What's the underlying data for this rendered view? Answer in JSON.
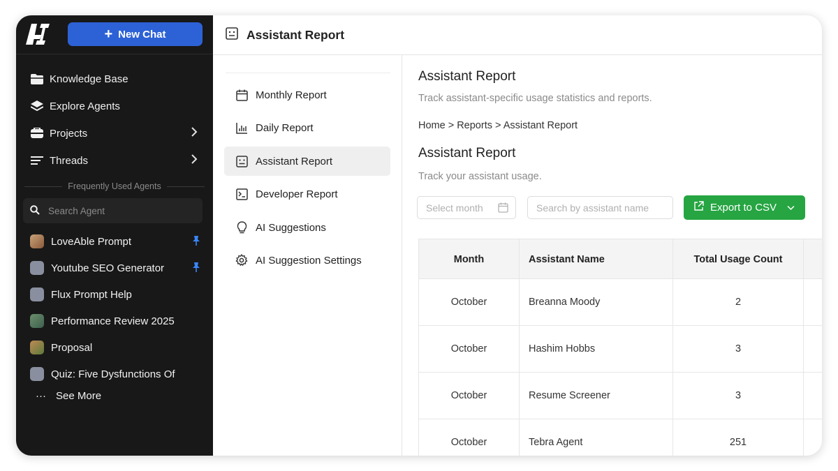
{
  "sidebar": {
    "new_chat_label": "New Chat",
    "nav": [
      {
        "label": "Knowledge Base",
        "icon": "folder-icon"
      },
      {
        "label": "Explore Agents",
        "icon": "layers-icon"
      },
      {
        "label": "Projects",
        "icon": "projects-icon"
      },
      {
        "label": "Threads",
        "icon": "threads-icon"
      }
    ],
    "frequently_used_label": "Frequently Used Agents",
    "search_placeholder": "Search Agent",
    "agents": [
      {
        "label": "LoveAble Prompt",
        "pinned": true
      },
      {
        "label": "Youtube SEO Generator",
        "pinned": true
      },
      {
        "label": "Flux Prompt Help",
        "pinned": false
      },
      {
        "label": "Performance Review 2025",
        "pinned": false
      },
      {
        "label": "Proposal",
        "pinned": false
      },
      {
        "label": "Quiz: Five Dysfunctions Of",
        "pinned": false
      }
    ],
    "see_more_label": "See More"
  },
  "header": {
    "title": "Assistant Report"
  },
  "submenu": [
    {
      "label": "Monthly Report",
      "icon": "calendar-icon"
    },
    {
      "label": "Daily Report",
      "icon": "bar-chart-icon"
    },
    {
      "label": "Assistant Report",
      "icon": "assistant-icon",
      "active": true
    },
    {
      "label": "Developer Report",
      "icon": "terminal-icon"
    },
    {
      "label": "AI Suggestions",
      "icon": "lightbulb-icon"
    },
    {
      "label": "AI Suggestion Settings",
      "icon": "gear-icon"
    }
  ],
  "main": {
    "title": "Assistant Report",
    "subtitle": "Track assistant-specific usage statistics and reports.",
    "breadcrumb": "Home > Reports > Assistant Report",
    "section_title": "Assistant Report",
    "section_subtitle": "Track your assistant usage.",
    "month_placeholder": "Select month",
    "name_placeholder": "Search by assistant name",
    "export_label": "Export to CSV"
  },
  "table": {
    "headers": [
      "Month",
      "Assistant Name",
      "Total Usage Count"
    ],
    "rows": [
      [
        "October",
        "Breanna Moody",
        "2"
      ],
      [
        "October",
        "Hashim Hobbs",
        "3"
      ],
      [
        "October",
        "Resume Screener",
        "3"
      ],
      [
        "October",
        "Tebra Agent",
        "251"
      ]
    ]
  },
  "colors": {
    "sidebar_bg": "#181818",
    "new_chat_blue": "#2d62d6",
    "export_green": "#26a542",
    "pin_blue": "#3a86ff"
  }
}
